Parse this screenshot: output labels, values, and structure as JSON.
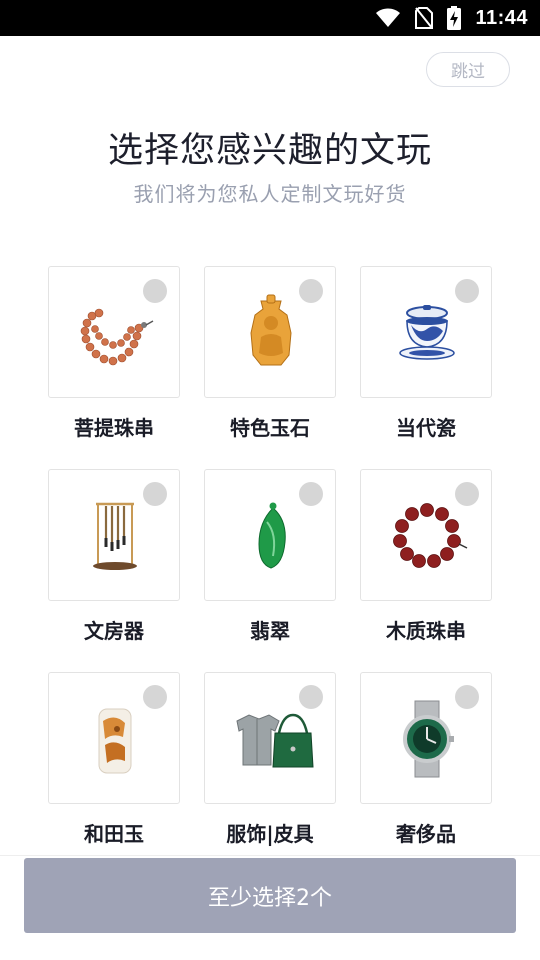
{
  "status_bar": {
    "time": "11:44",
    "icons": [
      "wifi-icon",
      "no-sim-icon",
      "battery-charging-icon"
    ]
  },
  "header": {
    "skip_label": "跳过",
    "title": "选择您感兴趣的文玩",
    "subtitle": "我们将为您私人定制文玩好货"
  },
  "categories": [
    {
      "label": "菩提珠串",
      "icon": "bodhi-bead-strand-image",
      "selected": false
    },
    {
      "label": "特色玉石",
      "icon": "jade-buddha-pendant-image",
      "selected": false
    },
    {
      "label": "当代瓷",
      "icon": "blue-white-porcelain-teacup-image",
      "selected": false
    },
    {
      "label": "文房器",
      "icon": "brush-rack-image",
      "selected": false
    },
    {
      "label": "翡翠",
      "icon": "green-jadeite-pendant-image",
      "selected": false
    },
    {
      "label": "木质珠串",
      "icon": "wooden-bead-bracelet-image",
      "selected": false
    },
    {
      "label": "和田玉",
      "icon": "hetian-jade-carving-image",
      "selected": false
    },
    {
      "label": "服饰|皮具",
      "icon": "clothing-and-handbag-image",
      "selected": false
    },
    {
      "label": "奢侈品",
      "icon": "luxury-watch-image",
      "selected": false
    }
  ],
  "footer": {
    "confirm_label": "至少选择2个"
  },
  "colors": {
    "confirm_disabled": "#9fa3b6",
    "check_unselected": "#d6d6d6",
    "title_text": "#1d1f2c",
    "subtitle_text": "#9aa0b0"
  }
}
